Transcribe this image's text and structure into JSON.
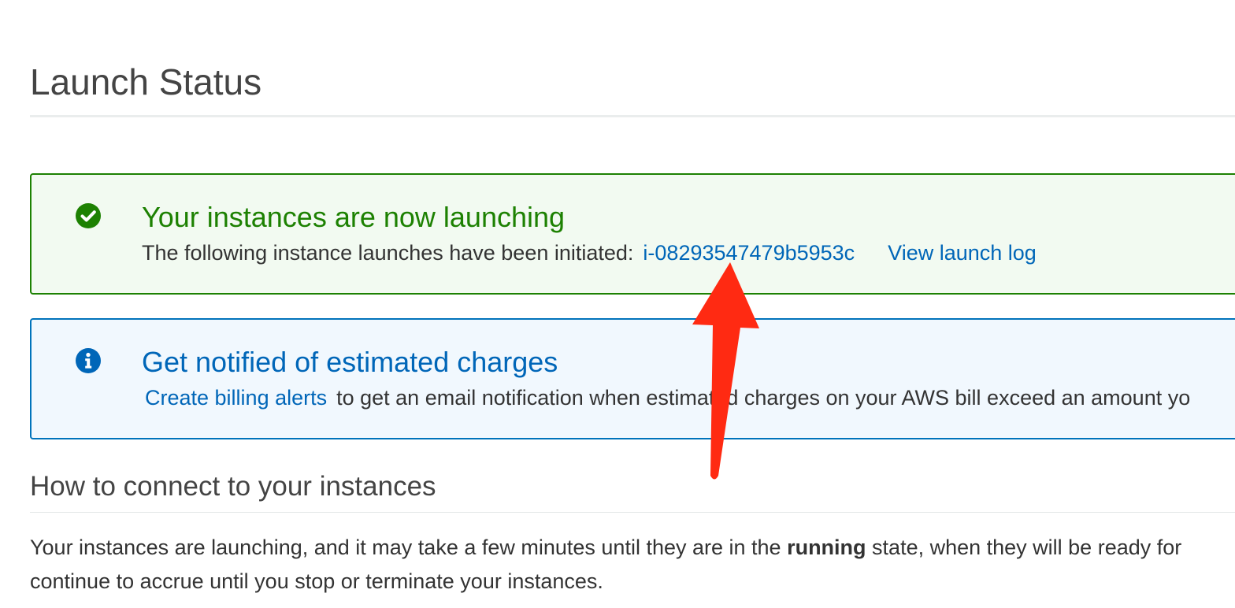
{
  "page": {
    "title": "Launch Status"
  },
  "success_alert": {
    "icon": "check-circle-icon",
    "color": "#1d8102",
    "heading": "Your instances are now launching",
    "body_text": "The following instance launches have been initiated:",
    "instance_id": "i-08293547479b5953c",
    "view_log_label": "View launch log"
  },
  "info_alert": {
    "icon": "info-circle-icon",
    "color": "#0073bb",
    "heading": "Get notified of estimated charges",
    "link_label": "Create billing alerts",
    "body_text": "to get an email notification when estimated charges on your AWS bill exceed an amount yo"
  },
  "connect_section": {
    "heading": "How to connect to your instances",
    "line1_before": "Your instances are launching, and it may take a few minutes until they are in the ",
    "line1_bold": "running",
    "line1_after": " state, when they will be ready for",
    "line2": "continue to accrue until you stop or terminate your instances."
  },
  "annotation": {
    "icon": "red-arrow-icon",
    "color": "#ff2a12"
  }
}
